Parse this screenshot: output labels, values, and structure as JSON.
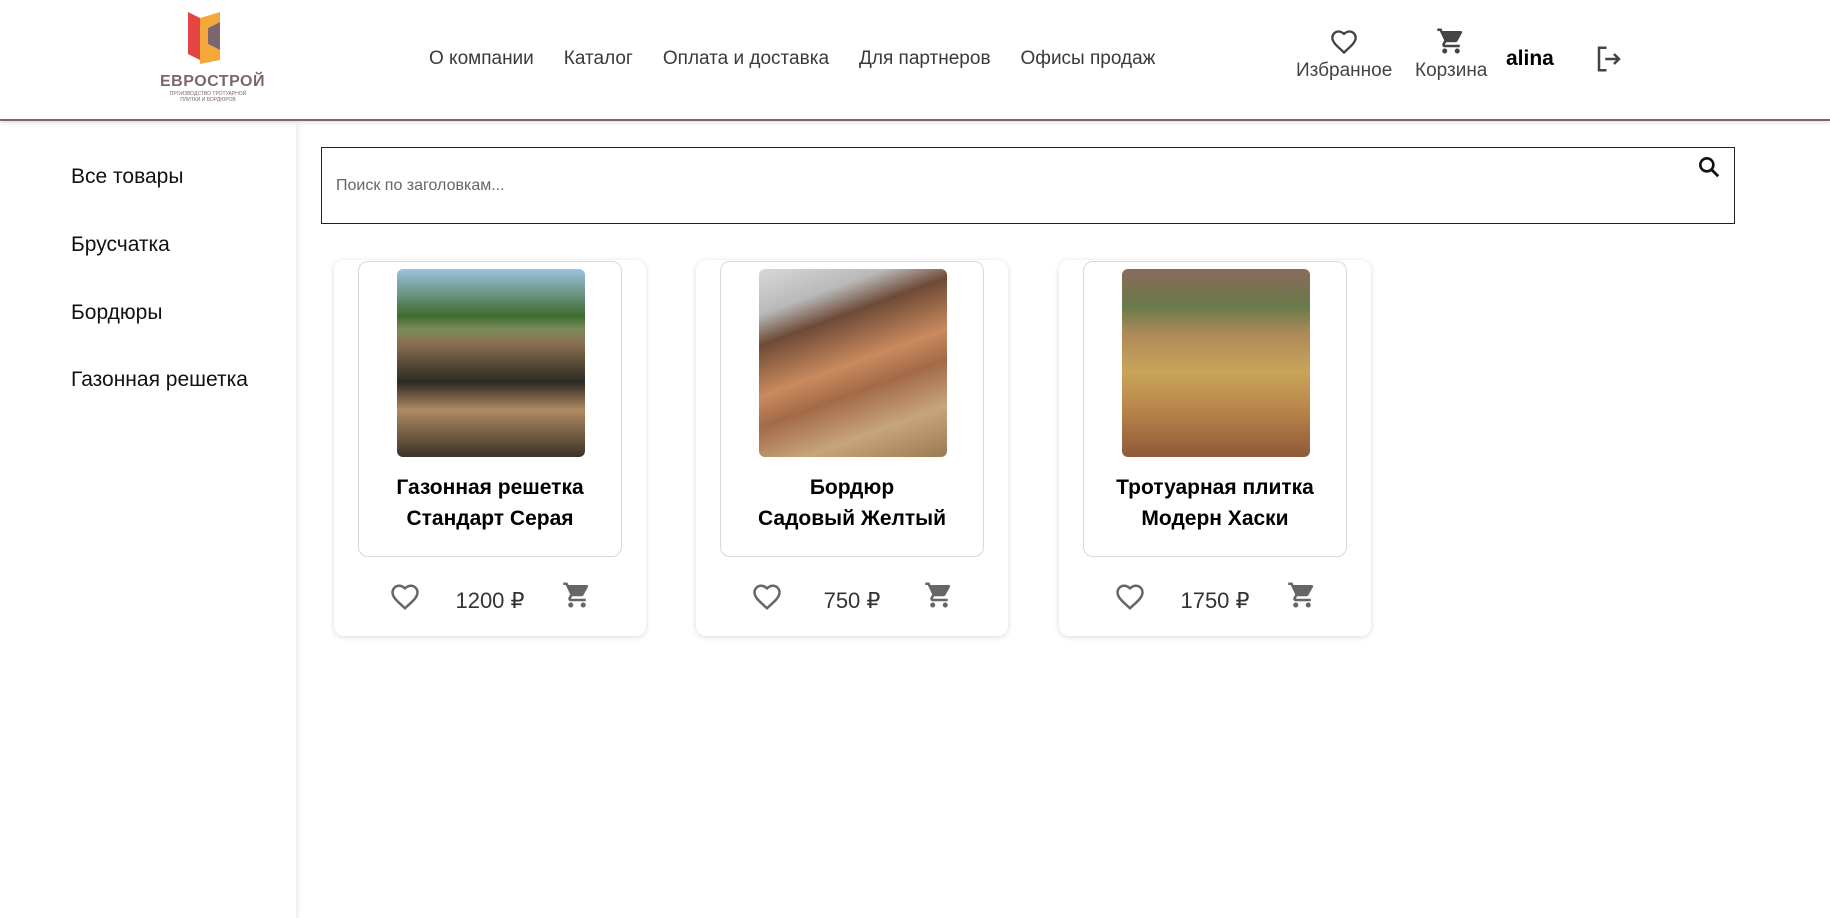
{
  "brand": {
    "name": "ЕВРОСТРОЙ",
    "tagline": "ПРОИЗВОДСТВО ТРОТУАРНОЙ ПЛИТКИ И БОРДЮРОВ"
  },
  "nav": [
    "О компании",
    "Каталог",
    "Оплата и доставка",
    "Для партнеров",
    "Офисы продаж"
  ],
  "header": {
    "favorites": "Избранное",
    "cart": "Корзина",
    "user": "alina"
  },
  "sidebar": [
    "Все товары",
    "Брусчатка",
    "Бордюры",
    "Газонная решетка"
  ],
  "search": {
    "placeholder": "Поиск по заголовкам...",
    "value": ""
  },
  "products": [
    {
      "title1": "Газонная решетка",
      "title2": "Стандарт Серая",
      "price": "1200 ₽"
    },
    {
      "title1": "Бордюр",
      "title2": "Садовый Желтый",
      "price": "750 ₽"
    },
    {
      "title1": "Тротуарная плитка",
      "title2": "Модерн Хаски",
      "price": "1750 ₽"
    }
  ],
  "colors": {
    "brand": "#7d6570",
    "accent_orange": "#f5a83a",
    "accent_red": "#e34444"
  }
}
